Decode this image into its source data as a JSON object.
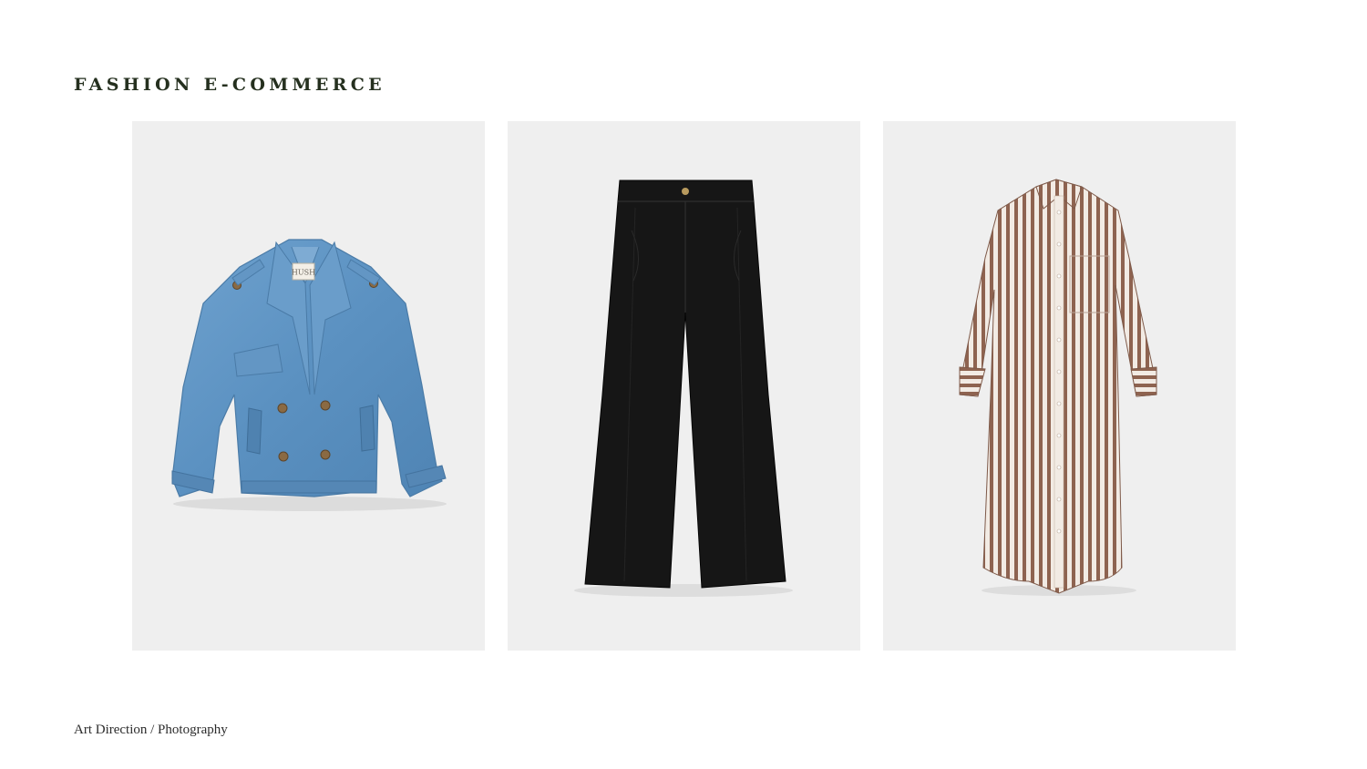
{
  "header": {
    "title": "FASHION E-COMMERCE"
  },
  "gallery": {
    "items": [
      {
        "name": "denim-jacket",
        "label_text": "HUSH"
      },
      {
        "name": "black-trousers"
      },
      {
        "name": "striped-shirt-dress"
      }
    ]
  },
  "footer": {
    "caption": "Art Direction / Photography"
  },
  "colors": {
    "title": "#25301f",
    "panel_bg": "#efefef",
    "denim": "#5e93c2",
    "trousers": "#141414",
    "stripe": "#8a5e4c"
  }
}
